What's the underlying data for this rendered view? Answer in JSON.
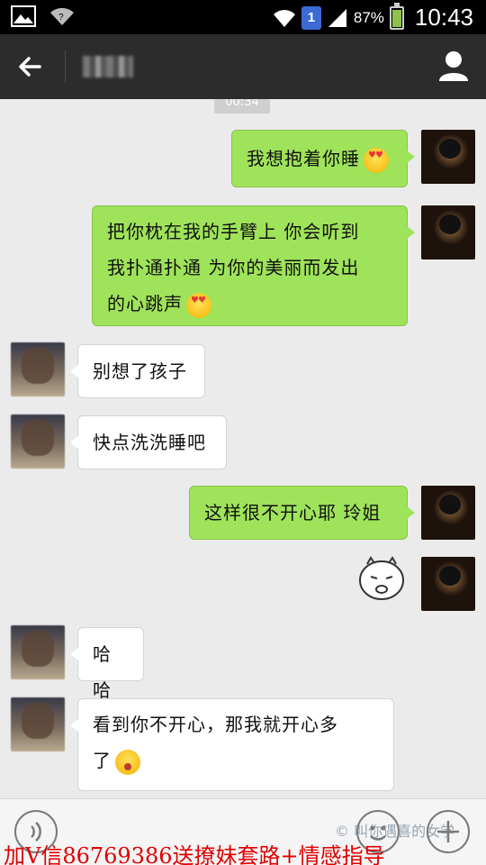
{
  "status_bar": {
    "sim_slot": "1",
    "battery": "87%",
    "time": "10:43",
    "icons": [
      "gallery-icon",
      "wifi-icon",
      "signal-icon",
      "battery-icon"
    ]
  },
  "header": {
    "contact_name": "••••",
    "back_icon": "arrow-left-icon",
    "profile_icon": "person-icon"
  },
  "chat": {
    "timestamp": "00:34",
    "messages": [
      {
        "sender": "me",
        "text": "我想抱着你睡",
        "emoji": "heart-eyes"
      },
      {
        "sender": "me",
        "text": "把你枕在我的手臂上 你会听到我扑通扑通 为你的美丽而发出的心跳声",
        "line1": "把你枕在我的手臂上 你会听到",
        "line2": "我扑通扑通 为你的美丽而发出",
        "line3": "的心跳声",
        "emoji": "heart-eyes"
      },
      {
        "sender": "her",
        "text": "别想了孩子"
      },
      {
        "sender": "her",
        "text": "快点洗洗睡吧"
      },
      {
        "sender": "me",
        "text": "这样很不开心耶 玲姐"
      },
      {
        "sender": "me",
        "sticker": "sad-face-sticker"
      },
      {
        "sender": "her",
        "text": "哈哈"
      },
      {
        "sender": "her",
        "text": "看到你不开心，那我就开心多了",
        "line1": "看到你不开心，那我就开心多",
        "line2": "了",
        "emoji": "embarrassed"
      }
    ]
  },
  "input_bar": {
    "watermark": "©  叫你遇喜的女学"
  },
  "overlay": {
    "ad_text": "加V信86769386送撩妹套路+情感指导"
  },
  "colors": {
    "outgoing_bubble": "#9fe35a",
    "incoming_bubble": "#ffffff",
    "chat_background": "#ebebeb",
    "header": "#2c2c2c",
    "ad_text": "#e00000"
  }
}
